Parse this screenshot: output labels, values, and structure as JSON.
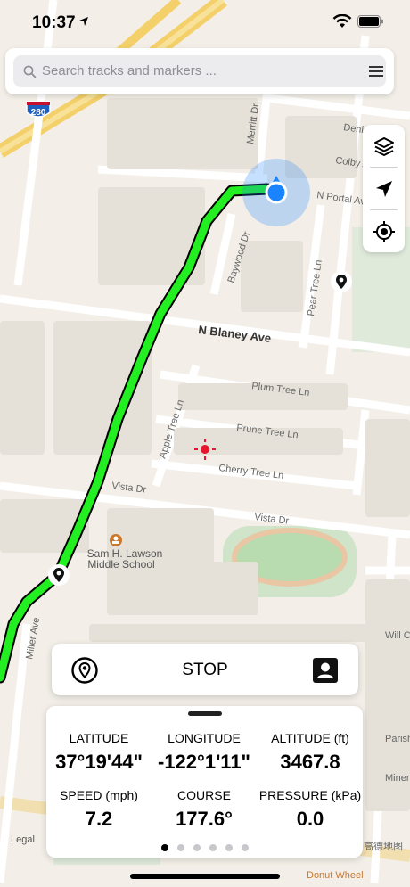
{
  "status_bar": {
    "time": "10:37"
  },
  "search": {
    "placeholder": "Search tracks and markers ..."
  },
  "map": {
    "streets": [
      "N Blaney Ave",
      "Plum Tree Ln",
      "Prune Tree Ln",
      "Cherry Tree Ln",
      "Vista Dr",
      "Apple Tree Ln",
      "Baywood Dr",
      "Merritt Dr",
      "N Portal Ave",
      "Denis",
      "Colby Ave",
      "Pear Tree Ln",
      "Miller Ave",
      "Will Ct",
      "Parish",
      "Miner",
      "Donut Wheel"
    ],
    "highway_shield": "280",
    "poi": "Sam H. Lawson Middle School",
    "legal": "Legal",
    "provider": "高德地图"
  },
  "recording": {
    "stop_label": "STOP"
  },
  "stats": {
    "latitude": {
      "label": "LATITUDE",
      "value": "37°19'44\""
    },
    "longitude": {
      "label": "LONGITUDE",
      "value": "-122°1'11\""
    },
    "altitude": {
      "label": "ALTITUDE (ft)",
      "value": "3467.8"
    },
    "speed": {
      "label": "SPEED (mph)",
      "value": "7.2"
    },
    "course": {
      "label": "COURSE",
      "value": "177.6°"
    },
    "pressure": {
      "label": "PRESSURE (kPa)",
      "value": "0.0"
    }
  },
  "pager": {
    "pages": 6,
    "active": 0
  },
  "colors": {
    "track": "#22ee22",
    "location": "#1a84ff",
    "marker": "#111111"
  }
}
